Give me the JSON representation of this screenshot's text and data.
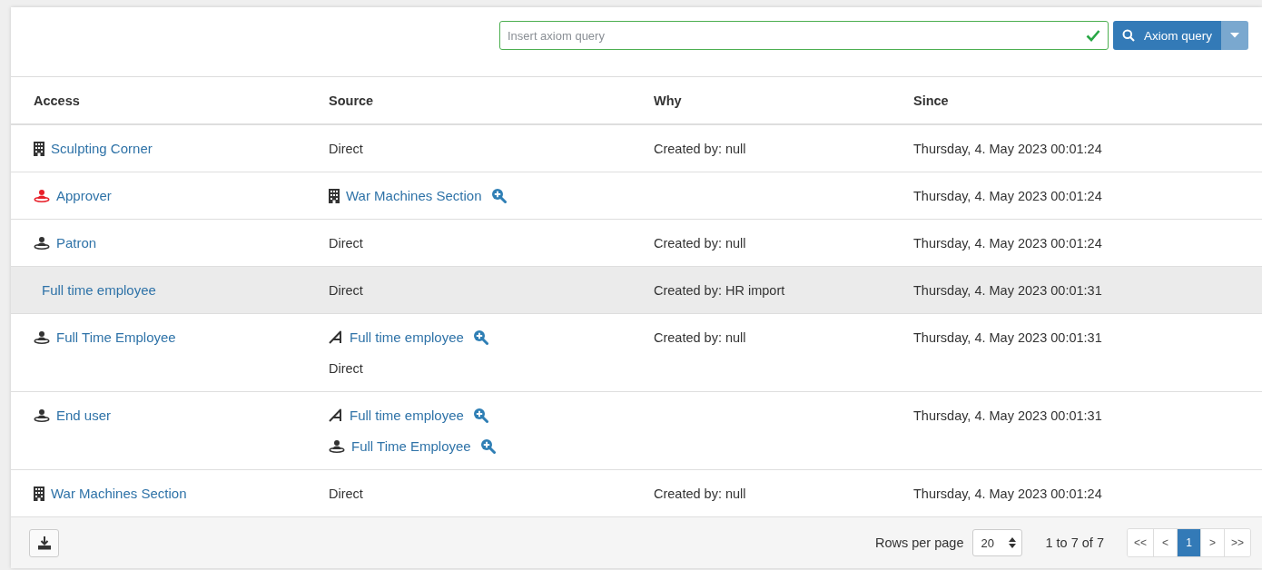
{
  "query": {
    "placeholder": "Insert axiom query",
    "valid": true
  },
  "query_button": {
    "label": "Axiom query"
  },
  "columns": [
    "Access",
    "Source",
    "Why",
    "Since"
  ],
  "rows": [
    {
      "selected": false,
      "access": {
        "kind": "building",
        "label": "Sculpting Corner"
      },
      "source": [
        {
          "kind": "text",
          "label": "Direct"
        }
      ],
      "why": "Created by: null",
      "since": "Thursday, 4. May 2023 00:01:24"
    },
    {
      "selected": false,
      "access": {
        "kind": "role",
        "color": "#e8202a",
        "label": "Approver"
      },
      "source": [
        {
          "kind": "building",
          "label": "War Machines Section"
        }
      ],
      "why": "",
      "since": "Thursday, 4. May 2023 00:01:24"
    },
    {
      "selected": false,
      "access": {
        "kind": "role",
        "color": "#333333",
        "label": "Patron"
      },
      "source": [
        {
          "kind": "text",
          "label": "Direct"
        }
      ],
      "why": "Created by: null",
      "since": "Thursday, 4. May 2023 00:01:24"
    },
    {
      "selected": true,
      "access": {
        "kind": "none",
        "label": "Full time employee"
      },
      "source": [
        {
          "kind": "text",
          "label": "Direct"
        }
      ],
      "why": "Created by: HR import",
      "since": "Thursday, 4. May 2023 00:01:31"
    },
    {
      "selected": false,
      "access": {
        "kind": "role",
        "color": "#333333",
        "label": "Full Time Employee"
      },
      "source": [
        {
          "kind": "rule",
          "label": "Full time employee"
        },
        {
          "kind": "text",
          "label": "Direct"
        }
      ],
      "why": "Created by: null",
      "since": "Thursday, 4. May 2023 00:01:31"
    },
    {
      "selected": false,
      "access": {
        "kind": "role",
        "color": "#333333",
        "label": "End user"
      },
      "source": [
        {
          "kind": "rule",
          "label": "Full time employee"
        },
        {
          "kind": "role",
          "label": "Full Time Employee"
        }
      ],
      "why": "",
      "since": "Thursday, 4. May 2023 00:01:31"
    },
    {
      "selected": false,
      "access": {
        "kind": "building",
        "label": "War Machines Section"
      },
      "source": [
        {
          "kind": "text",
          "label": "Direct"
        }
      ],
      "why": "Created by: null",
      "since": "Thursday, 4. May 2023 00:01:24"
    }
  ],
  "footer": {
    "rows_per_page_label": "Rows per page",
    "rows_per_page": "20",
    "range": "1 to 7 of 7",
    "pages": [
      {
        "label": "<<",
        "selected": false
      },
      {
        "label": "<",
        "selected": false
      },
      {
        "label": "1",
        "selected": true
      },
      {
        "label": ">",
        "selected": false
      },
      {
        "label": ">>",
        "selected": false
      }
    ]
  }
}
